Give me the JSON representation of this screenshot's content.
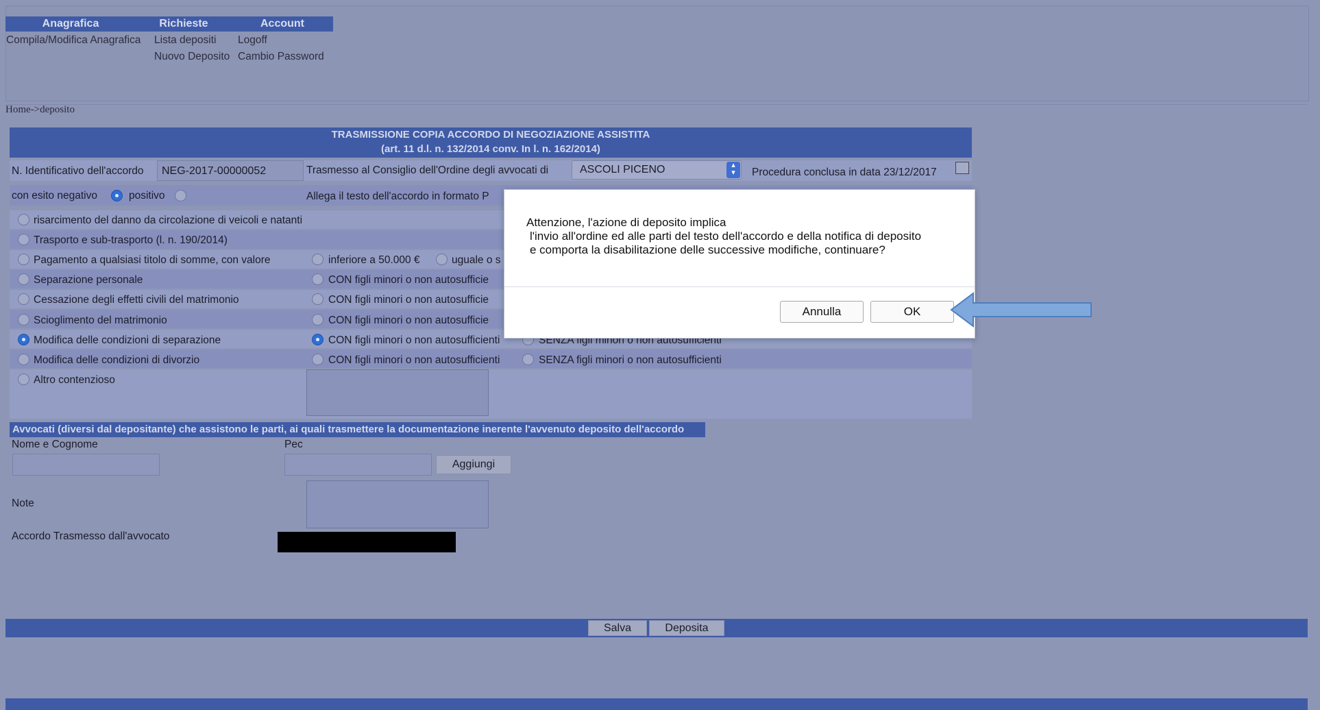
{
  "menu": {
    "heads": [
      "Anagrafica",
      "Richieste",
      "Account"
    ],
    "links": {
      "compila": "Compila/Modifica Anagrafica",
      "lista": "Lista depositi",
      "logoff": "Logoff",
      "nuovo": "Nuovo Deposito",
      "cambio": "Cambio Password"
    }
  },
  "breadcrumb": "Home->deposito",
  "form": {
    "title_line1": "TRASMISSIONE COPIA ACCORDO DI NEGOZIAZIONE ASSISTITA",
    "title_line2": "(art. 11 d.l. n. 132/2014 conv. In l. n. 162/2014)",
    "id_label": "N. Identificativo dell'accordo",
    "id_value": "NEG-2017-00000052",
    "council_label": "Trasmesso al Consiglio dell'Ordine degli avvocati di",
    "council_value": "ASCOLI PICENO",
    "procedure_label": "Procedura conclusa in data 23/12/2017",
    "outcome_label": "con esito negativo",
    "outcome_positive": "positivo",
    "attach_label": "Allega il testo dell'accordo in formato P",
    "options": [
      "risarcimento del danno da circolazione di veicoli e natanti",
      "Trasporto e sub-trasporto (l. n. 190/2014)",
      "Pagamento a qualsiasi titolo di somme, con valore",
      "Separazione personale",
      "Cessazione degli effetti civili del matrimonio",
      "Scioglimento del matrimonio",
      "Modifica delle condizioni di separazione",
      "Modifica delle condizioni di divorzio",
      "Altro contenzioso"
    ],
    "value_lt": "inferiore a 50.000 €",
    "value_eq": "uguale o s",
    "con_figli": "CON figli minori o non autosufficie",
    "con_figli_full": "CON figli minori o non autosufficienti",
    "senza_figli": "SENZA figli minori o non autosufficienti"
  },
  "lawyers": {
    "header": "Avvocati (diversi dal depositante) che assistono le parti, ai quali trasmettere la documentazione inerente l'avvenuto deposito dell'accordo",
    "name_label": "Nome e Cognome",
    "pec_label": "Pec",
    "add_button": "Aggiungi",
    "note_label": "Note",
    "transmitted_label": "Accordo Trasmesso dall'avvocato"
  },
  "actions": {
    "save": "Salva",
    "deposit": "Deposita"
  },
  "modal": {
    "line1": "Attenzione, l'azione di deposito implica",
    "line2": "l'invio all'ordine ed alle parti del testo dell'accordo e della notifica di deposito",
    "line3": "e comporta la disabilitazione delle successive modifiche,  continuare?",
    "cancel": "Annulla",
    "ok": "OK"
  },
  "colors": {
    "accent": "#3f5ba6",
    "background": "#8e96b6",
    "arrow": "#7fa8dc"
  }
}
